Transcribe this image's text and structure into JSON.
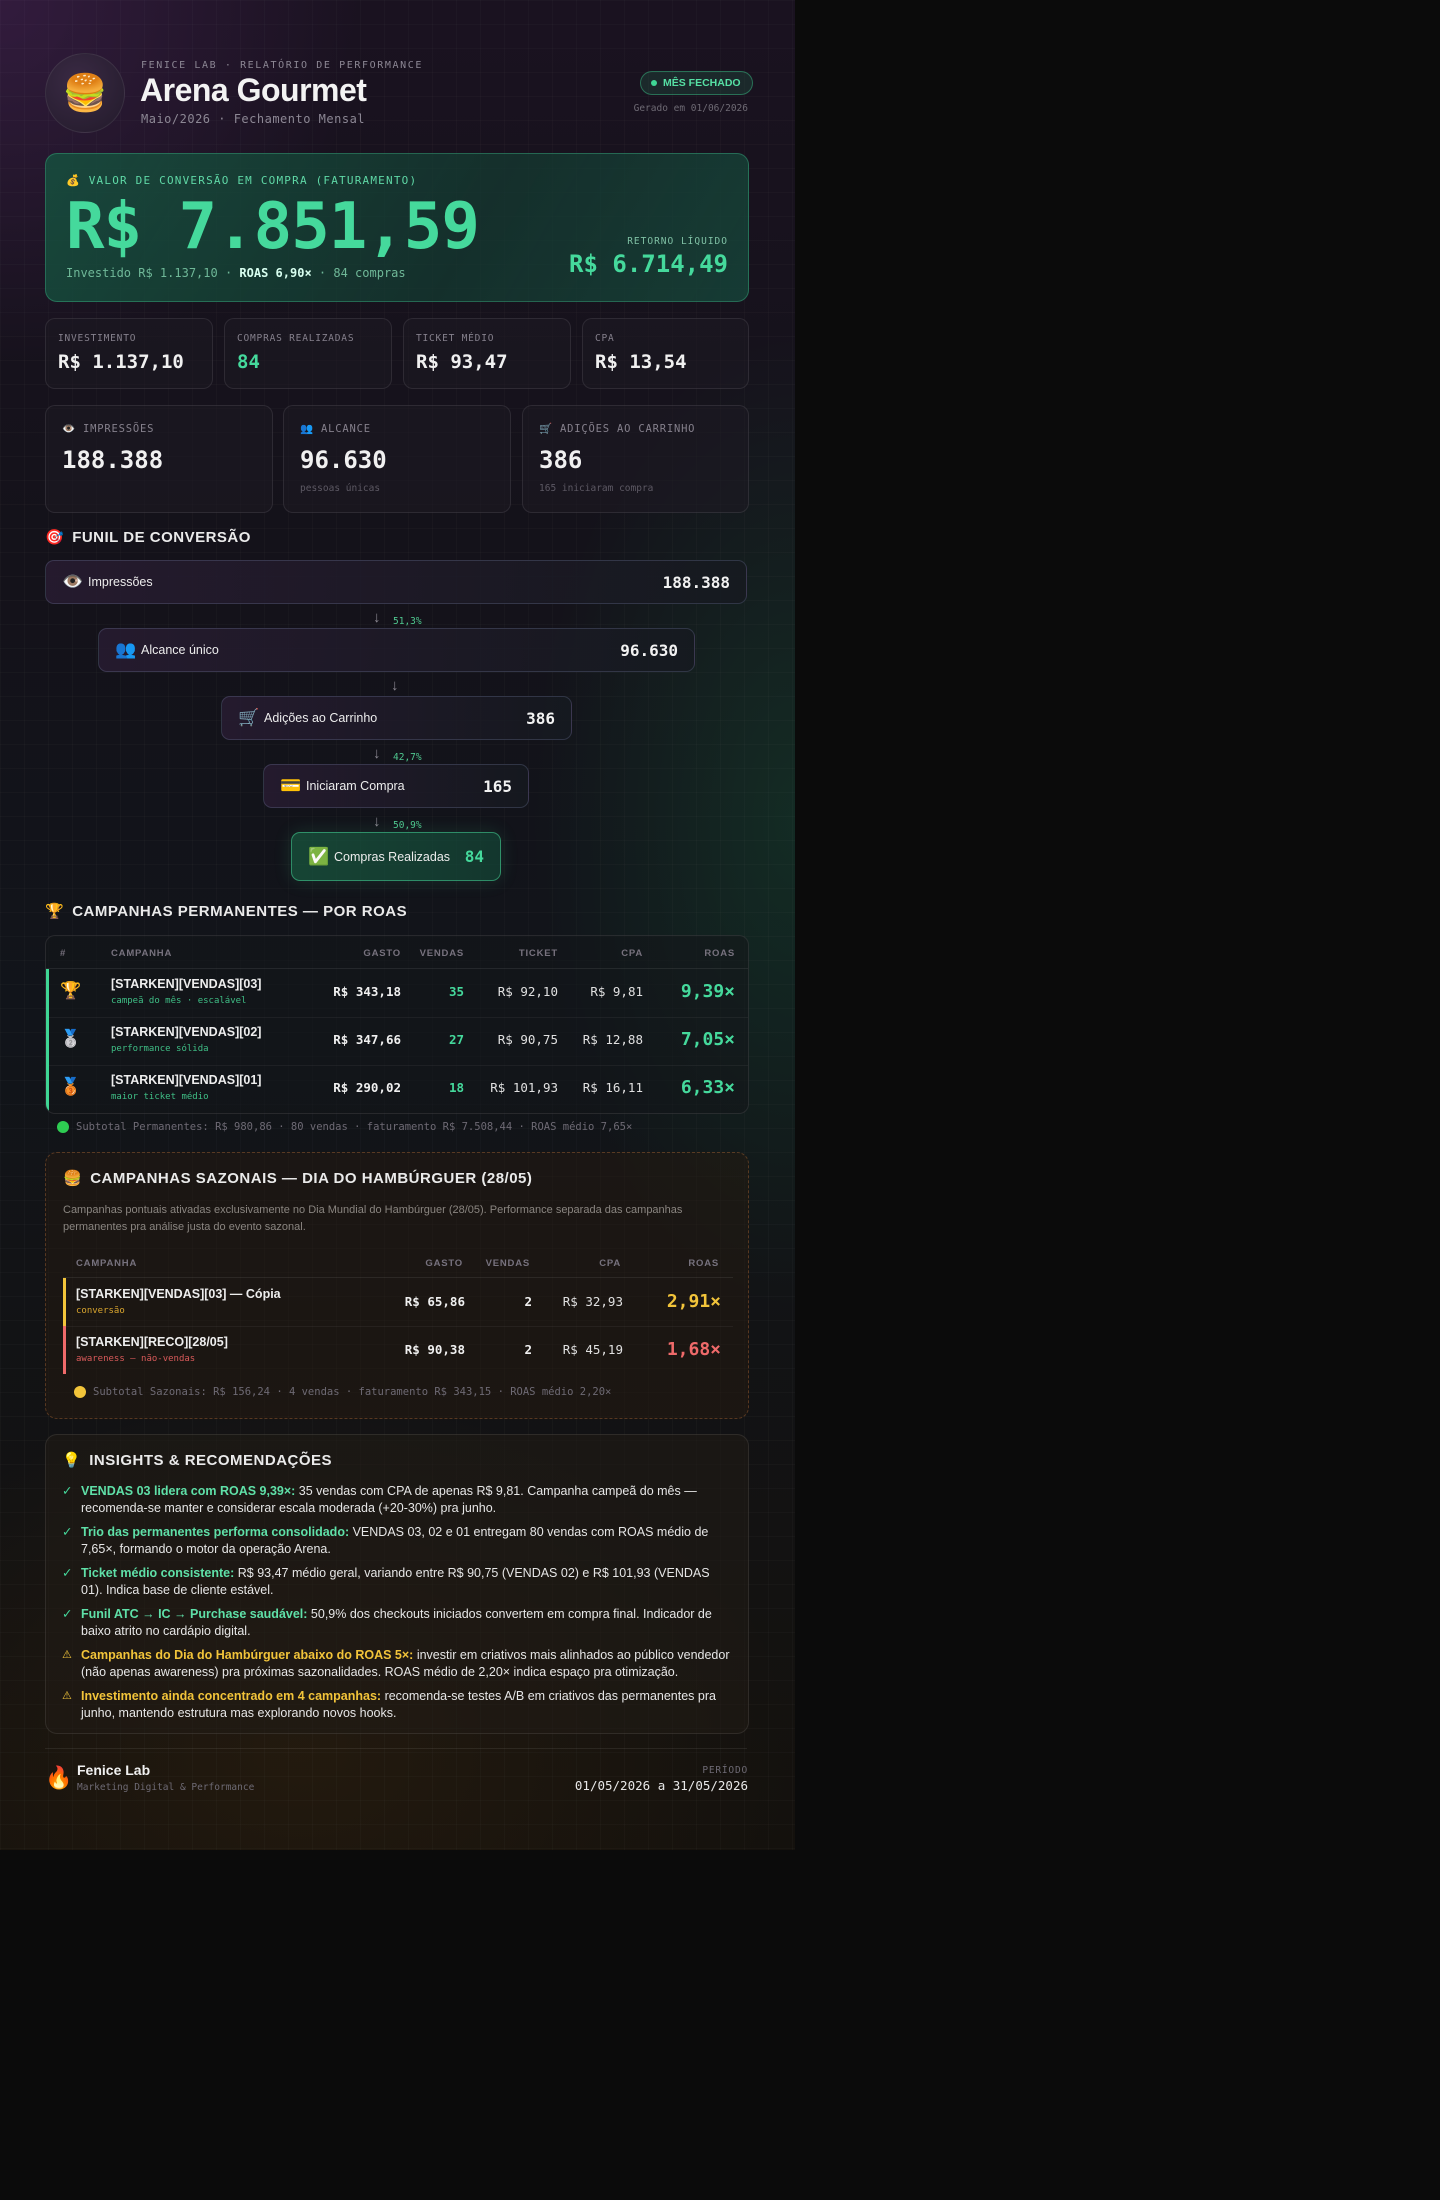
{
  "header": {
    "kicker": "FENICE LAB · RELATÓRIO DE PERFORMANCE",
    "brand": "Arena Gourmet",
    "period": "Maio/2026 · Fechamento Mensal",
    "badge": "MÊS FECHADO",
    "generated": "Gerado em 01/06/2026",
    "logo_icon": "burger-icon"
  },
  "hero": {
    "label": "VALOR DE CONVERSÃO EM COMPRA (FATURAMENTO)",
    "value": "R$ 7.851,59",
    "invested": "Investido R$ 1.137,10",
    "sep1": "·",
    "roas": "ROAS 6,90×",
    "sep2": "·",
    "purchases": "84 compras",
    "return_label": "RETORNO LÍQUIDO",
    "return_value": "R$ 6.714,49"
  },
  "kpis": [
    {
      "label": "INVESTIMENTO",
      "value": "R$ 1.137,10"
    },
    {
      "label": "COMPRAS REALIZADAS",
      "value": "84"
    },
    {
      "label": "TICKET MÉDIO",
      "value": "R$ 93,47"
    },
    {
      "label": "CPA",
      "value": "R$ 13,54"
    }
  ],
  "metrics": [
    {
      "label": "IMPRESSÕES",
      "value": "188.388",
      "note": ""
    },
    {
      "label": "ALCANCE",
      "value": "96.630",
      "note": "pessoas únicas"
    },
    {
      "label": "ADIÇÕES AO CARRINHO",
      "value": "386",
      "note": "165 iniciaram compra"
    }
  ],
  "funnel": {
    "title": "FUNIL DE CONVERSÃO",
    "steps": [
      {
        "label": "Impressões",
        "value": "188.388"
      },
      {
        "label": "Alcance único",
        "value": "96.630"
      },
      {
        "label": "Adições ao Carrinho",
        "value": "386"
      },
      {
        "label": "Iniciaram Compra",
        "value": "165"
      },
      {
        "label": "Compras Realizadas",
        "value": "84"
      }
    ],
    "rates": [
      "51,3%",
      "",
      "42,7%",
      "50,9%"
    ]
  },
  "permanent": {
    "title": "CAMPANHAS PERMANENTES — POR ROAS",
    "columns": [
      "#",
      "CAMPANHA",
      "GASTO",
      "VENDAS",
      "TICKET",
      "CPA",
      "ROAS"
    ],
    "rows": [
      {
        "rank_icon": "trophy-icon",
        "name": "[STARKEN][VENDAS][03]",
        "sub": "campeã do mês · escalável",
        "spend": "R$ 343,18",
        "sales": "35",
        "ticket": "R$ 92,10",
        "cpa": "R$ 9,81",
        "roas": "9,39×"
      },
      {
        "rank_icon": "silver-medal-icon",
        "name": "[STARKEN][VENDAS][02]",
        "sub": "performance sólida",
        "spend": "R$ 347,66",
        "sales": "27",
        "ticket": "R$ 90,75",
        "cpa": "R$ 12,88",
        "roas": "7,05×"
      },
      {
        "rank_icon": "bronze-medal-icon",
        "name": "[STARKEN][VENDAS][01]",
        "sub": "maior ticket médio",
        "spend": "R$ 290,02",
        "sales": "18",
        "ticket": "R$ 101,93",
        "cpa": "R$ 16,11",
        "roas": "6,33×"
      }
    ],
    "subtotal": "Subtotal Permanentes: R$ 980,86 · 80 vendas · faturamento R$ 7.508,44 · ROAS médio 7,65×"
  },
  "seasonal": {
    "title": "CAMPANHAS SAZONAIS — DIA DO HAMBÚRGUER (28/05)",
    "description": "Campanhas pontuais ativadas exclusivamente no Dia Mundial do Hambúrguer (28/05). Performance separada das campanhas permanentes pra análise justa do evento sazonal.",
    "columns": [
      "CAMPANHA",
      "GASTO",
      "VENDAS",
      "CPA",
      "ROAS"
    ],
    "rows": [
      {
        "name": "[STARKEN][VENDAS][03] — Cópia",
        "sub": "conversão",
        "spend": "R$ 65,86",
        "sales": "2",
        "cpa": "R$ 32,93",
        "roas": "2,91×",
        "color": "#f2c43a"
      },
      {
        "name": "[STARKEN][RECO][28/05]",
        "sub": "awareness — não-vendas",
        "spend": "R$ 90,38",
        "sales": "2",
        "cpa": "R$ 45,19",
        "roas": "1,68×",
        "color": "#ef6a6a"
      }
    ],
    "subtotal": "Subtotal Sazonais: R$ 156,24 · 4 vendas · faturamento R$ 343,15 · ROAS médio 2,20×"
  },
  "insights": {
    "title": "INSIGHTS & RECOMENDAÇÕES",
    "items": [
      {
        "type": "ok",
        "mark": "✓",
        "head": "VENDAS 03 lidera com ROAS 9,39×:",
        "text": " 35 vendas com CPA de apenas R$ 9,81. Campanha campeã do mês — recomenda-se manter e considerar escala moderada (+20-30%) pra junho."
      },
      {
        "type": "ok",
        "mark": "✓",
        "head": "Trio das permanentes performa consolidado:",
        "text": " VENDAS 03, 02 e 01 entregam 80 vendas com ROAS médio de 7,65×, formando o motor da operação Arena."
      },
      {
        "type": "ok",
        "mark": "✓",
        "head": "Ticket médio consistente:",
        "text": " R$ 93,47 médio geral, variando entre R$ 90,75 (VENDAS 02) e R$ 101,93 (VENDAS 01). Indica base de cliente estável."
      },
      {
        "type": "ok",
        "mark": "✓",
        "head": "Funil ATC → IC → Purchase saudável:",
        "text": " 50,9% dos checkouts iniciados convertem em compra final. Indicador de baixo atrito no cardápio digital."
      },
      {
        "type": "warn",
        "mark": "⚠",
        "head": "Campanhas do Dia do Hambúrguer abaixo do ROAS 5×:",
        "text": " investir em criativos mais alinhados ao público vendedor (não apenas awareness) pra próximas sazonalidades. ROAS médio de 2,20× indica espaço pra otimização."
      },
      {
        "type": "warn",
        "mark": "⚠",
        "head": "Investimento ainda concentrado em 4 campanhas:",
        "text": " recomenda-se testes A/B em criativos das permanentes pra junho, mantendo estrutura mas explorando novos hooks."
      }
    ]
  },
  "footer": {
    "brand": "Fenice Lab",
    "tagline": "Marketing Digital & Performance",
    "period_label": "PERÍODO",
    "period": "01/05/2026 a 31/05/2026"
  },
  "colors": {
    "accent_green": "#45d99c",
    "warn_yellow": "#f2c43a",
    "alert_red": "#ef6a6a",
    "background": "#0b0b0b"
  }
}
